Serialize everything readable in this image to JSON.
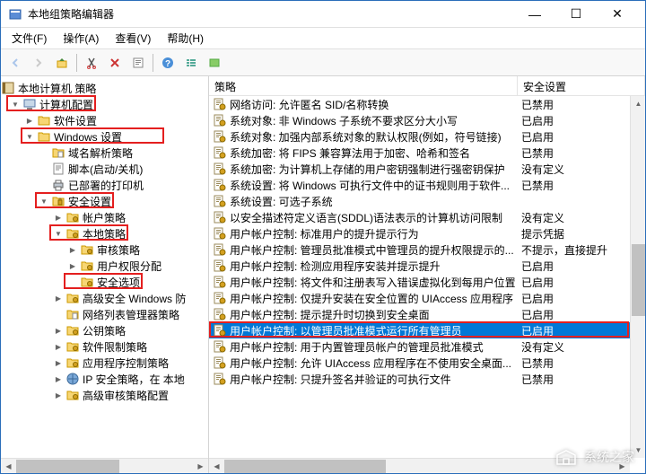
{
  "window": {
    "title": "本地组策略编辑器"
  },
  "menu": {
    "file": "文件(F)",
    "action": "操作(A)",
    "view": "查看(V)",
    "help": "帮助(H)"
  },
  "tree": {
    "root": "本地计算机 策略",
    "items": [
      {
        "level": 0,
        "toggle": "▼",
        "icon": "computer",
        "label": "计算机配置",
        "hl": true
      },
      {
        "level": 1,
        "toggle": "▶",
        "icon": "folder",
        "label": "软件设置"
      },
      {
        "level": 1,
        "toggle": "▼",
        "icon": "folder",
        "label": "Windows 设置",
        "hl": true
      },
      {
        "level": 2,
        "toggle": "",
        "icon": "folder-doc",
        "label": "域名解析策略"
      },
      {
        "level": 2,
        "toggle": "",
        "icon": "script",
        "label": "脚本(启动/关机)"
      },
      {
        "level": 2,
        "toggle": "",
        "icon": "printer",
        "label": "已部署的打印机"
      },
      {
        "level": 2,
        "toggle": "▼",
        "icon": "security",
        "label": "安全设置",
        "hl": true
      },
      {
        "level": 3,
        "toggle": "▶",
        "icon": "folder-s",
        "label": "帐户策略"
      },
      {
        "level": 3,
        "toggle": "▼",
        "icon": "folder-s",
        "label": "本地策略",
        "hl": true
      },
      {
        "level": 4,
        "toggle": "▶",
        "icon": "folder-s",
        "label": "审核策略"
      },
      {
        "level": 4,
        "toggle": "▶",
        "icon": "folder-s",
        "label": "用户权限分配"
      },
      {
        "level": 4,
        "toggle": "",
        "icon": "folder-s",
        "label": "安全选项",
        "hl": true,
        "selected": false
      },
      {
        "level": 3,
        "toggle": "▶",
        "icon": "folder-s",
        "label": "高级安全 Windows 防"
      },
      {
        "level": 3,
        "toggle": "",
        "icon": "folder-doc",
        "label": "网络列表管理器策略"
      },
      {
        "level": 3,
        "toggle": "▶",
        "icon": "folder-s",
        "label": "公钥策略"
      },
      {
        "level": 3,
        "toggle": "▶",
        "icon": "folder-s",
        "label": "软件限制策略"
      },
      {
        "level": 3,
        "toggle": "▶",
        "icon": "folder-s",
        "label": "应用程序控制策略"
      },
      {
        "level": 3,
        "toggle": "▶",
        "icon": "ipsec",
        "label": "IP 安全策略，在 本地"
      },
      {
        "level": 3,
        "toggle": "▶",
        "icon": "folder-s",
        "label": "高级审核策略配置"
      }
    ]
  },
  "list": {
    "col_policy": "策略",
    "col_setting": "安全设置",
    "rows": [
      {
        "p": "网络访问: 允许匿名 SID/名称转换",
        "s": "已禁用"
      },
      {
        "p": "系统对象: 非 Windows 子系统不要求区分大小写",
        "s": "已启用"
      },
      {
        "p": "系统对象: 加强内部系统对象的默认权限(例如，符号链接)",
        "s": "已启用"
      },
      {
        "p": "系统加密: 将 FIPS 兼容算法用于加密、哈希和签名",
        "s": "已禁用"
      },
      {
        "p": "系统加密: 为计算机上存储的用户密钥强制进行强密钥保护",
        "s": "没有定义"
      },
      {
        "p": "系统设置: 将 Windows 可执行文件中的证书规则用于软件...",
        "s": "已禁用"
      },
      {
        "p": "系统设置: 可选子系统",
        "s": ""
      },
      {
        "p": "以安全描述符定义语言(SDDL)语法表示的计算机访问限制",
        "s": "没有定义"
      },
      {
        "p": "用户帐户控制: 标准用户的提升提示行为",
        "s": "提示凭据"
      },
      {
        "p": "用户帐户控制: 管理员批准模式中管理员的提升权限提示的...",
        "s": "不提示，直接提升"
      },
      {
        "p": "用户帐户控制: 检测应用程序安装并提示提升",
        "s": "已启用"
      },
      {
        "p": "用户帐户控制: 将文件和注册表写入错误虚拟化到每用户位置",
        "s": "已启用"
      },
      {
        "p": "用户帐户控制: 仅提升安装在安全位置的 UIAccess 应用程序",
        "s": "已启用"
      },
      {
        "p": "用户帐户控制: 提示提升时切换到安全桌面",
        "s": "已启用"
      },
      {
        "p": "用户帐户控制: 以管理员批准模式运行所有管理员",
        "s": "已启用",
        "selected": true,
        "hl": true
      },
      {
        "p": "用户帐户控制: 用于内置管理员帐户的管理员批准模式",
        "s": "没有定义"
      },
      {
        "p": "用户帐户控制: 允许 UIAccess 应用程序在不使用安全桌面...",
        "s": "已禁用"
      },
      {
        "p": "用户帐户控制: 只提升签名并验证的可执行文件",
        "s": "已禁用"
      }
    ]
  },
  "watermark": "系统之家"
}
